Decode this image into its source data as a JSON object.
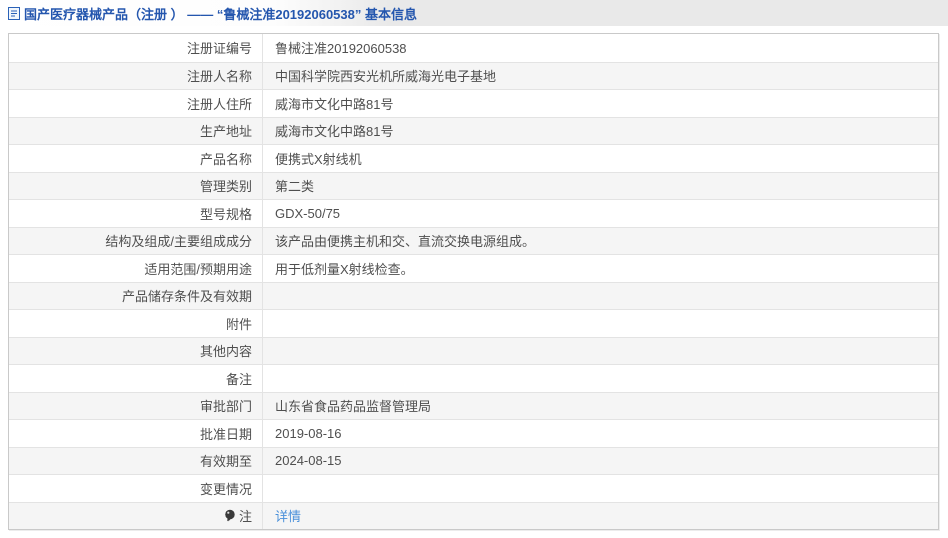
{
  "header": {
    "icon": "document-icon",
    "title": "国产医疗器械产品（注册 ） —— “鲁械注准20192060538” 基本信息"
  },
  "table": {
    "rows": [
      {
        "label": "注册证编号",
        "value": "鲁械注准20192060538"
      },
      {
        "label": "注册人名称",
        "value": "中国科学院西安光机所威海光电子基地"
      },
      {
        "label": "注册人住所",
        "value": "威海市文化中路81号"
      },
      {
        "label": "生产地址",
        "value": "威海市文化中路81号"
      },
      {
        "label": "产品名称",
        "value": "便携式X射线机"
      },
      {
        "label": "管理类别",
        "value": "第二类"
      },
      {
        "label": "型号规格",
        "value": "GDX-50/75"
      },
      {
        "label": "结构及组成/主要组成成分",
        "value": "该产品由便携主机和交、直流交换电源组成。"
      },
      {
        "label": "适用范围/预期用途",
        "value": "用于低剂量X射线检查。"
      },
      {
        "label": "产品储存条件及有效期",
        "value": ""
      },
      {
        "label": "附件",
        "value": ""
      },
      {
        "label": "其他内容",
        "value": ""
      },
      {
        "label": "备注",
        "value": ""
      },
      {
        "label": "审批部门",
        "value": "山东省食品药品监督管理局"
      },
      {
        "label": "批准日期",
        "value": "2019-08-16"
      },
      {
        "label": "有效期至",
        "value": "2024-08-15"
      },
      {
        "label": "变更情况",
        "value": ""
      },
      {
        "label": "注",
        "value": "详情",
        "link": true,
        "label_icon": "note-balloon-icon"
      }
    ]
  },
  "colors": {
    "title_blue": "#2456ae",
    "link_blue": "#4a90da",
    "row_alt": "#f5f5f5",
    "border_outer": "#c9c9c9",
    "border_inner": "#e3e3e3",
    "text": "#4f4f4f",
    "header_gray": "#e9e9e9"
  }
}
